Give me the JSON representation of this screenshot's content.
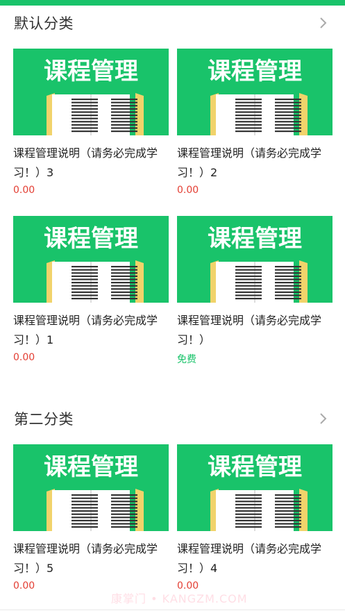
{
  "theme": {
    "accent": "#19c36a",
    "price_color": "#e33e33",
    "free_color": "#19c36a"
  },
  "sections": [
    {
      "title": "默认分类",
      "more_icon": "chevron-right-icon",
      "courses": [
        {
          "thumb_text": "课程管理",
          "title": "课程管理说明（请务必完成学习！）3",
          "price": "0.00"
        },
        {
          "thumb_text": "课程管理",
          "title": "课程管理说明（请务必完成学习！）2",
          "price": "0.00"
        },
        {
          "thumb_text": "课程管理",
          "title": "课程管理说明（请务必完成学习！）1",
          "price": "0.00"
        },
        {
          "thumb_text": "课程管理",
          "title": "课程管理说明（请务必完成学习！）",
          "price": "免费"
        }
      ]
    },
    {
      "title": "第二分类",
      "more_icon": "chevron-right-icon",
      "courses": [
        {
          "thumb_text": "课程管理",
          "title": "课程管理说明（请务必完成学习！）5",
          "price": "0.00"
        },
        {
          "thumb_text": "课程管理",
          "title": "课程管理说明（请务必完成学习！）4",
          "price": "0.00"
        }
      ]
    }
  ],
  "watermark": "康掌门 • KANGZM.COM"
}
